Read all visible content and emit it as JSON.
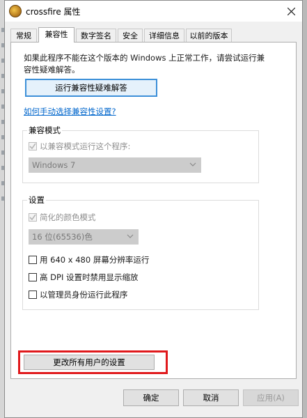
{
  "window": {
    "title": "crossfire 属性",
    "app_icon": "crossfire-icon"
  },
  "tabs": [
    {
      "label": "常规",
      "active": false
    },
    {
      "label": "兼容性",
      "active": true
    },
    {
      "label": "数字签名",
      "active": false
    },
    {
      "label": "安全",
      "active": false
    },
    {
      "label": "详细信息",
      "active": false
    },
    {
      "label": "以前的版本",
      "active": false
    }
  ],
  "compat": {
    "intro_line1": "如果此程序不能在这个版本的 Windows 上正常工作，请尝试运行兼",
    "intro_line2": "容性疑难解答。",
    "troubleshooter_button": "运行兼容性疑难解答",
    "manual_link": "如何手动选择兼容性设置?",
    "mode_group": {
      "label": "兼容模式",
      "checkbox_label": "以兼容模式运行这个程序:",
      "checkbox_checked": true,
      "checkbox_disabled": true,
      "os_select_value": "Windows 7"
    },
    "settings_group": {
      "label": "设置",
      "reduced_color": {
        "label": "简化的颜色模式",
        "checked": true,
        "disabled": true
      },
      "color_select_value": "16 位(65536)色",
      "options": [
        {
          "label": "用 640 x 480 屏幕分辨率运行",
          "checked": false
        },
        {
          "label": "高 DPI 设置时禁用显示缩放",
          "checked": false
        },
        {
          "label": "以管理员身份运行此程序",
          "checked": false
        }
      ]
    },
    "all_users_button": "更改所有用户的设置"
  },
  "footer": {
    "ok": "确定",
    "cancel": "取消",
    "apply": "应用(A)",
    "apply_disabled": true
  },
  "colors": {
    "highlight": "#e0191c",
    "link": "#0066cc",
    "focus": "#3c8fd8"
  }
}
